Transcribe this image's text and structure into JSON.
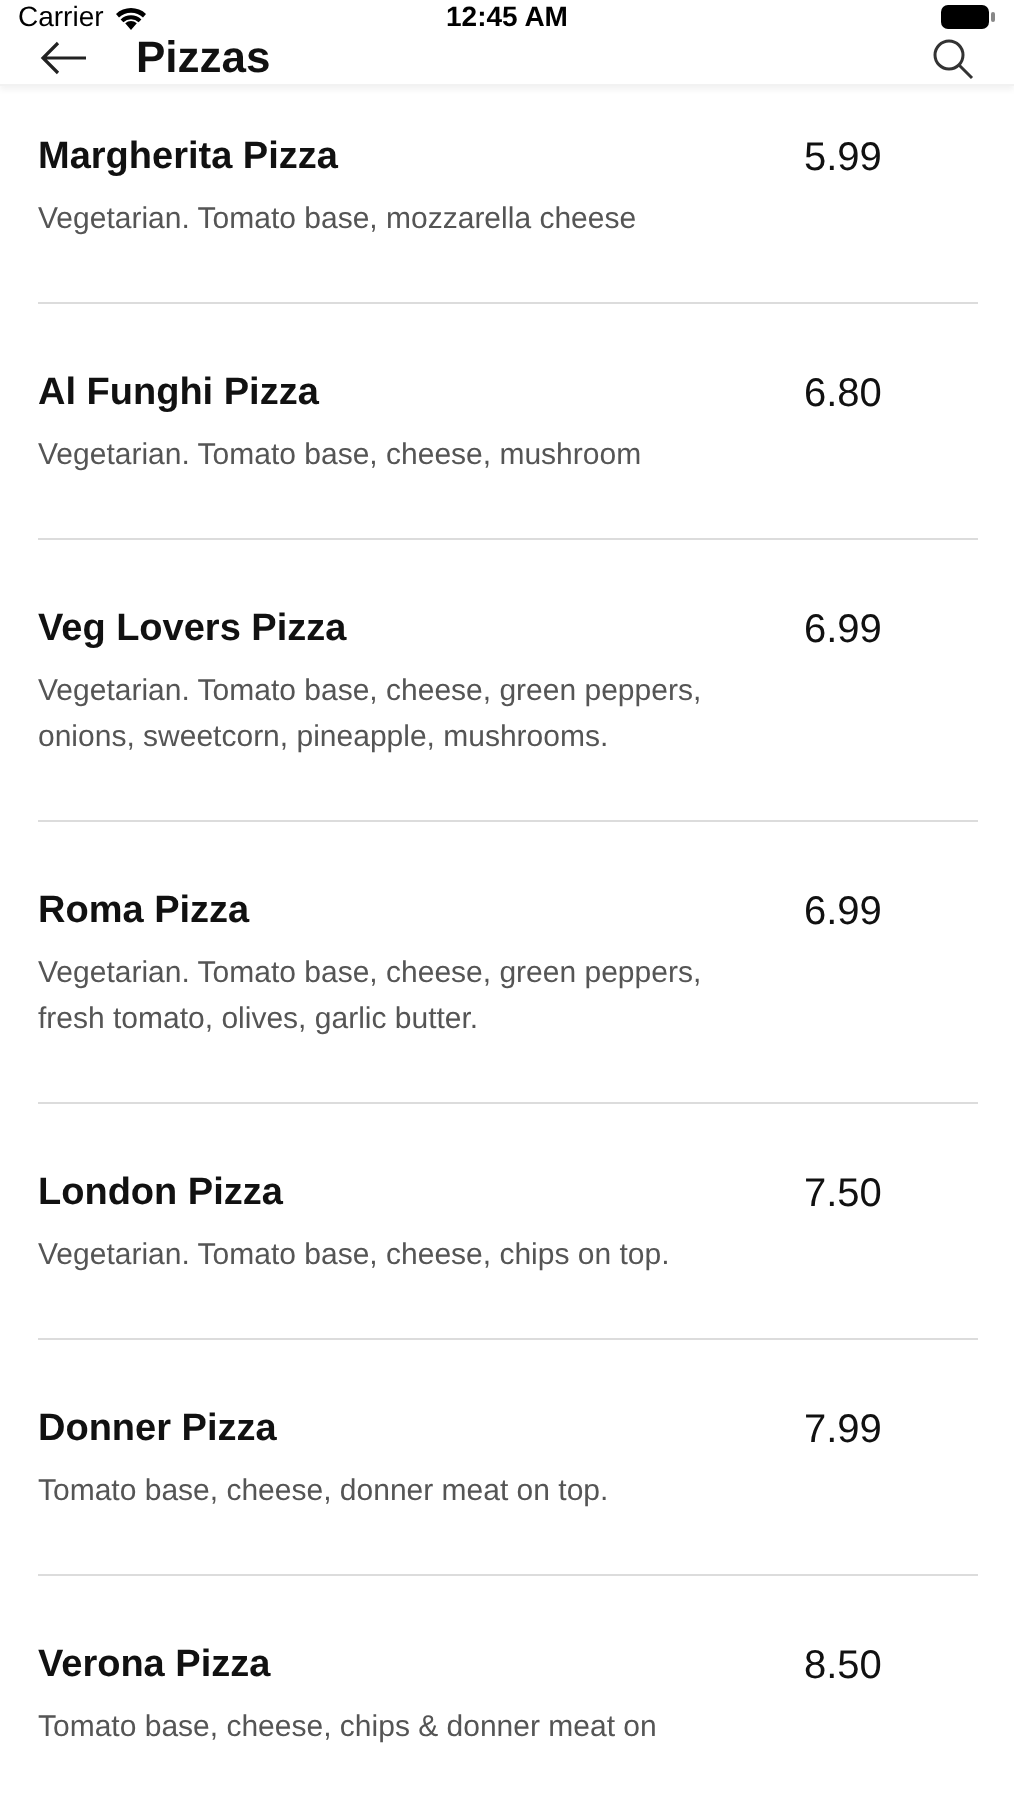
{
  "status_bar": {
    "carrier": "Carrier",
    "time": "12:45 AM"
  },
  "header": {
    "title": "Pizzas"
  },
  "items": [
    {
      "name": "Margherita Pizza",
      "price": "5.99",
      "description": "Vegetarian. Tomato base, mozzarella cheese"
    },
    {
      "name": "Al Funghi Pizza",
      "price": "6.80",
      "description": "Vegetarian. Tomato base, cheese, mushroom"
    },
    {
      "name": "Veg Lovers Pizza",
      "price": "6.99",
      "description": "Vegetarian. Tomato base, cheese, green peppers, onions, sweetcorn, pineapple, mushrooms."
    },
    {
      "name": "Roma Pizza",
      "price": "6.99",
      "description": "Vegetarian. Tomato base, cheese, green peppers, fresh tomato, olives, garlic butter."
    },
    {
      "name": "London Pizza",
      "price": "7.50",
      "description": "Vegetarian. Tomato base, cheese, chips on top."
    },
    {
      "name": "Donner Pizza",
      "price": "7.99",
      "description": "Tomato base, cheese, donner meat on top."
    },
    {
      "name": "Verona Pizza",
      "price": "8.50",
      "description": "Tomato base, cheese, chips & donner meat on"
    }
  ]
}
